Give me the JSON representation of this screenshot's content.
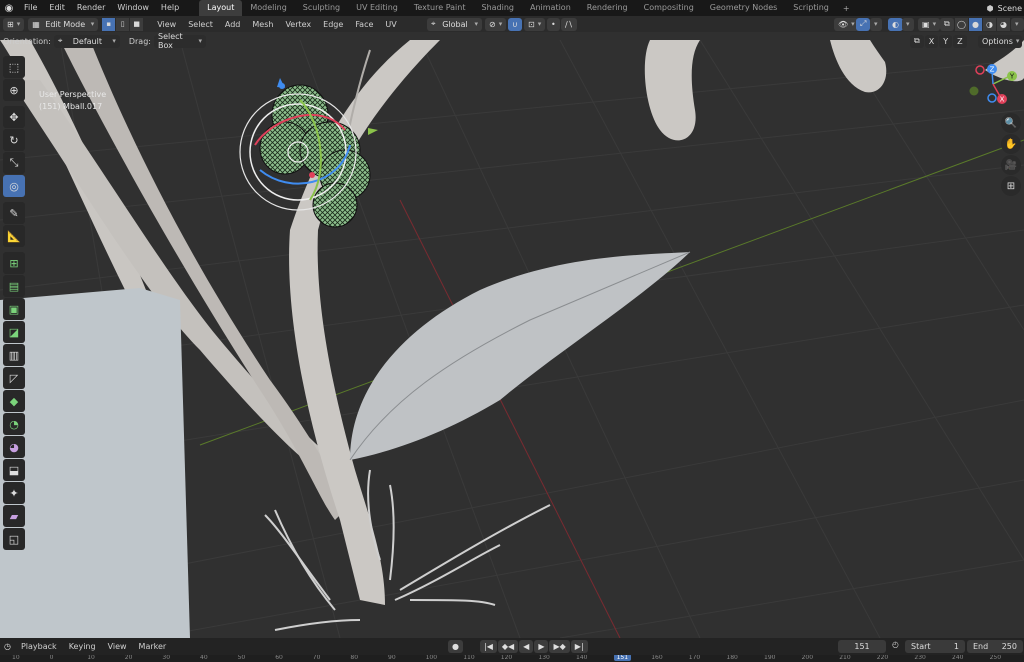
{
  "topbar": {
    "menus": [
      "File",
      "Edit",
      "Render",
      "Window",
      "Help"
    ],
    "workspaces": [
      "Layout",
      "Modeling",
      "Sculpting",
      "UV Editing",
      "Texture Paint",
      "Shading",
      "Animation",
      "Rendering",
      "Compositing",
      "Geometry Nodes",
      "Scripting"
    ],
    "active_workspace": "Layout",
    "add_label": "+",
    "scene_label": "Scene"
  },
  "header": {
    "mode": "Edit Mode",
    "menus": [
      "View",
      "Select",
      "Add",
      "Mesh",
      "Vertex",
      "Edge",
      "Face",
      "UV"
    ],
    "transform_orientation": "Global"
  },
  "tool_settings": {
    "orientation_label": "Orientation:",
    "orientation_value": "Default",
    "drag_label": "Drag:",
    "drag_value": "Select Box",
    "axes": [
      "X",
      "Y",
      "Z"
    ],
    "options_label": "Options"
  },
  "viewport": {
    "view_name": "User Perspective",
    "object_info": "(151) Mball.017"
  },
  "toolbar": {
    "tools": [
      "select-box-icon",
      "cursor-icon",
      "move-icon",
      "rotate-icon",
      "scale-icon",
      "transform-icon",
      "annotate-icon",
      "measure-icon",
      "add-cube-icon",
      "extrude-icon",
      "inset-icon",
      "bevel-icon",
      "loop-cut-icon",
      "knife-icon",
      "poly-build-icon",
      "spin-icon",
      "smooth-icon",
      "edge-slide-icon",
      "shrink-fatten-icon",
      "shear-icon",
      "rip-icon"
    ],
    "active_index": 5
  },
  "gizmo_axes": {
    "x": "X",
    "y": "Y",
    "z": "Z"
  },
  "timeline": {
    "menus": [
      "Playback",
      "Keying",
      "View",
      "Marker"
    ],
    "current_frame": "151",
    "start_label": "Start",
    "start_value": "1",
    "end_label": "End",
    "end_value": "250",
    "ruler_ticks": [
      "10",
      "0",
      "10",
      "20",
      "30",
      "40",
      "50",
      "60",
      "70",
      "80",
      "90",
      "100",
      "110",
      "120",
      "130",
      "140",
      "151",
      "160",
      "170",
      "180",
      "190",
      "200",
      "210",
      "220",
      "230",
      "240",
      "250"
    ]
  },
  "colors": {
    "accent": "#4772b3",
    "x_axis": "#e0405a",
    "y_axis": "#8bc34a",
    "z_axis": "#3f8cf0",
    "viewport_bg": "#303030",
    "mesh_fill": "#c8cdd0"
  }
}
